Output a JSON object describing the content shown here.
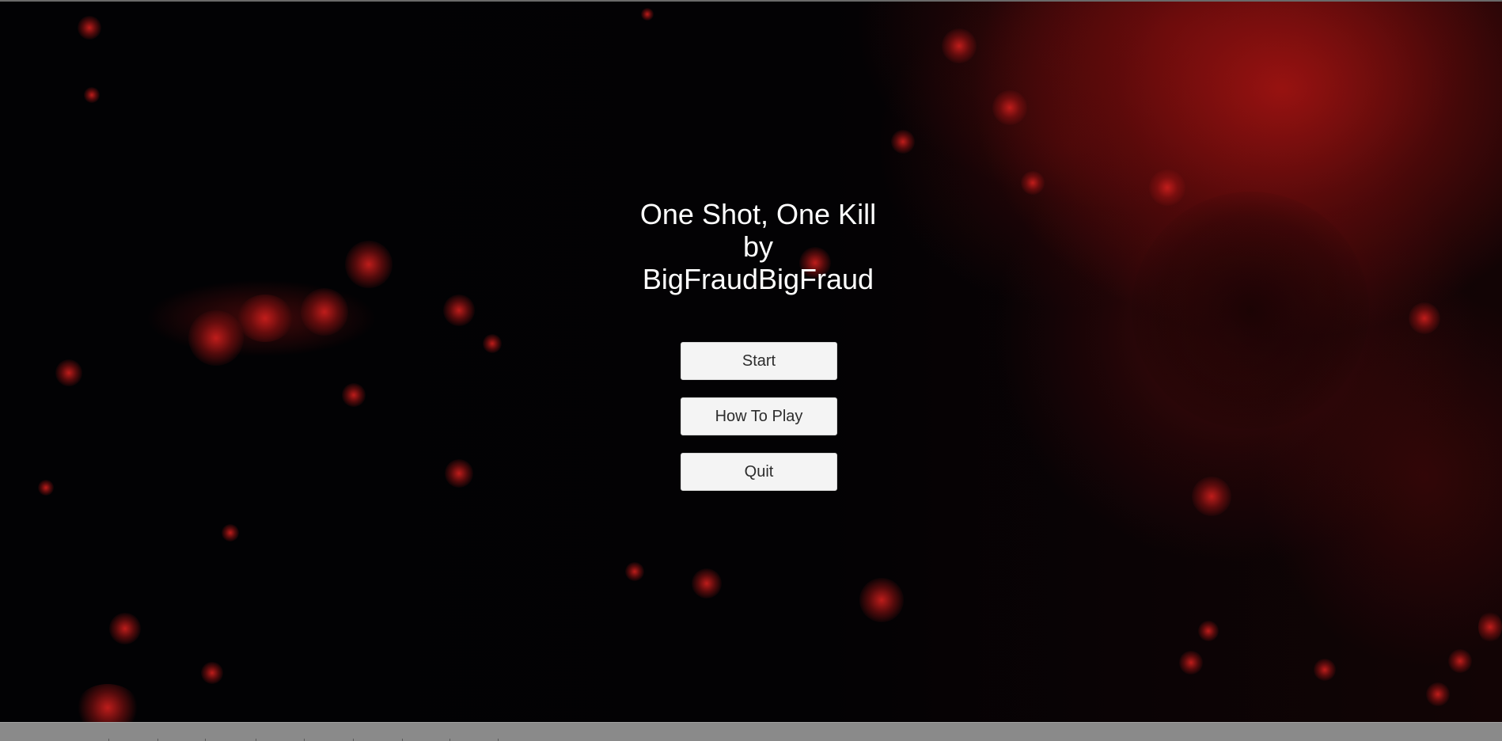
{
  "game": {
    "title_line1": "One Shot, One Kill",
    "title_line2": "by",
    "title_line3": "BigFraudBigFraud"
  },
  "menu": {
    "start_label": "Start",
    "how_to_play_label": "How To Play",
    "quit_label": "Quit"
  },
  "colors": {
    "background": "#020204",
    "nebula_red": "#a01412",
    "title_text": "#ffffff",
    "button_bg": "#f4f4f4",
    "button_text": "#2d2d2d",
    "bottom_bar": "#8a8a8a"
  }
}
